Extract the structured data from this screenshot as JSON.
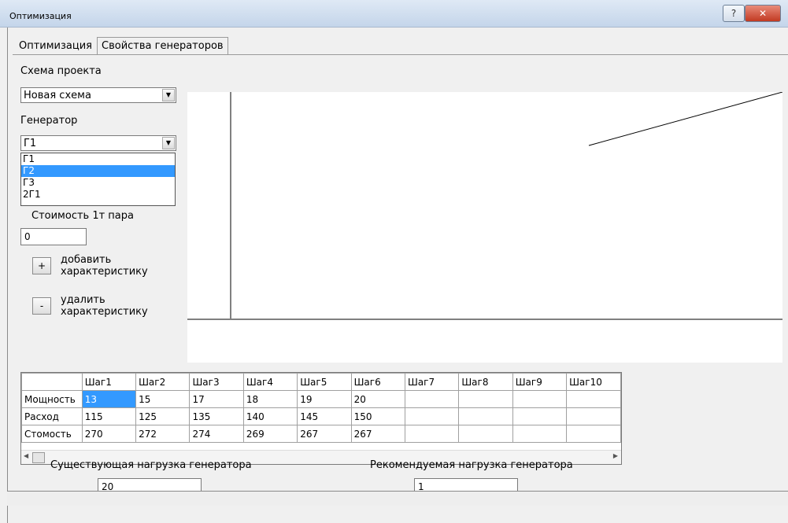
{
  "window": {
    "title": "Оптимизация"
  },
  "tabs": [
    {
      "label": "Оптимизация"
    },
    {
      "label": "Свойства генераторов"
    }
  ],
  "left_panel": {
    "scheme_label": "Схема проекта",
    "scheme_value": "Новая схема",
    "generator_label": "Генератор",
    "generator_value": "Г1",
    "generator_options": [
      "Г1",
      "Г2",
      "Г3",
      "2Г1"
    ],
    "steam_cost_label": "Стоимость 1т пара",
    "steam_cost_value": "0",
    "add_button": "+",
    "add_label": "добавить характеристику",
    "remove_button": "-",
    "remove_label": "удалить характеристику"
  },
  "table": {
    "columns": [
      "",
      "Шаг1",
      "Шаг2",
      "Шаг3",
      "Шаг4",
      "Шаг5",
      "Шаг6",
      "Шаг7",
      "Шаг8",
      "Шаг9",
      "Шаг10"
    ],
    "rows": [
      {
        "label": "Мощность",
        "cells": [
          "13",
          "15",
          "17",
          "18",
          "19",
          "20",
          "",
          "",
          "",
          ""
        ]
      },
      {
        "label": "Расход",
        "cells": [
          "115",
          "125",
          "135",
          "140",
          "145",
          "150",
          "",
          "",
          "",
          ""
        ]
      },
      {
        "label": "Стомость",
        "cells": [
          "270",
          "272",
          "274",
          "269",
          "267",
          "267",
          "",
          "",
          "",
          ""
        ]
      }
    ]
  },
  "bottom": {
    "current_load_label": "Существующая нагрузка генератора",
    "current_load_value": "20",
    "recommended_load_label": "Рекомендуемая нагрузка генератора",
    "recommended_load_value": "1"
  },
  "colors": {
    "selection": "#3399ff",
    "close_button": "#c23a22"
  }
}
